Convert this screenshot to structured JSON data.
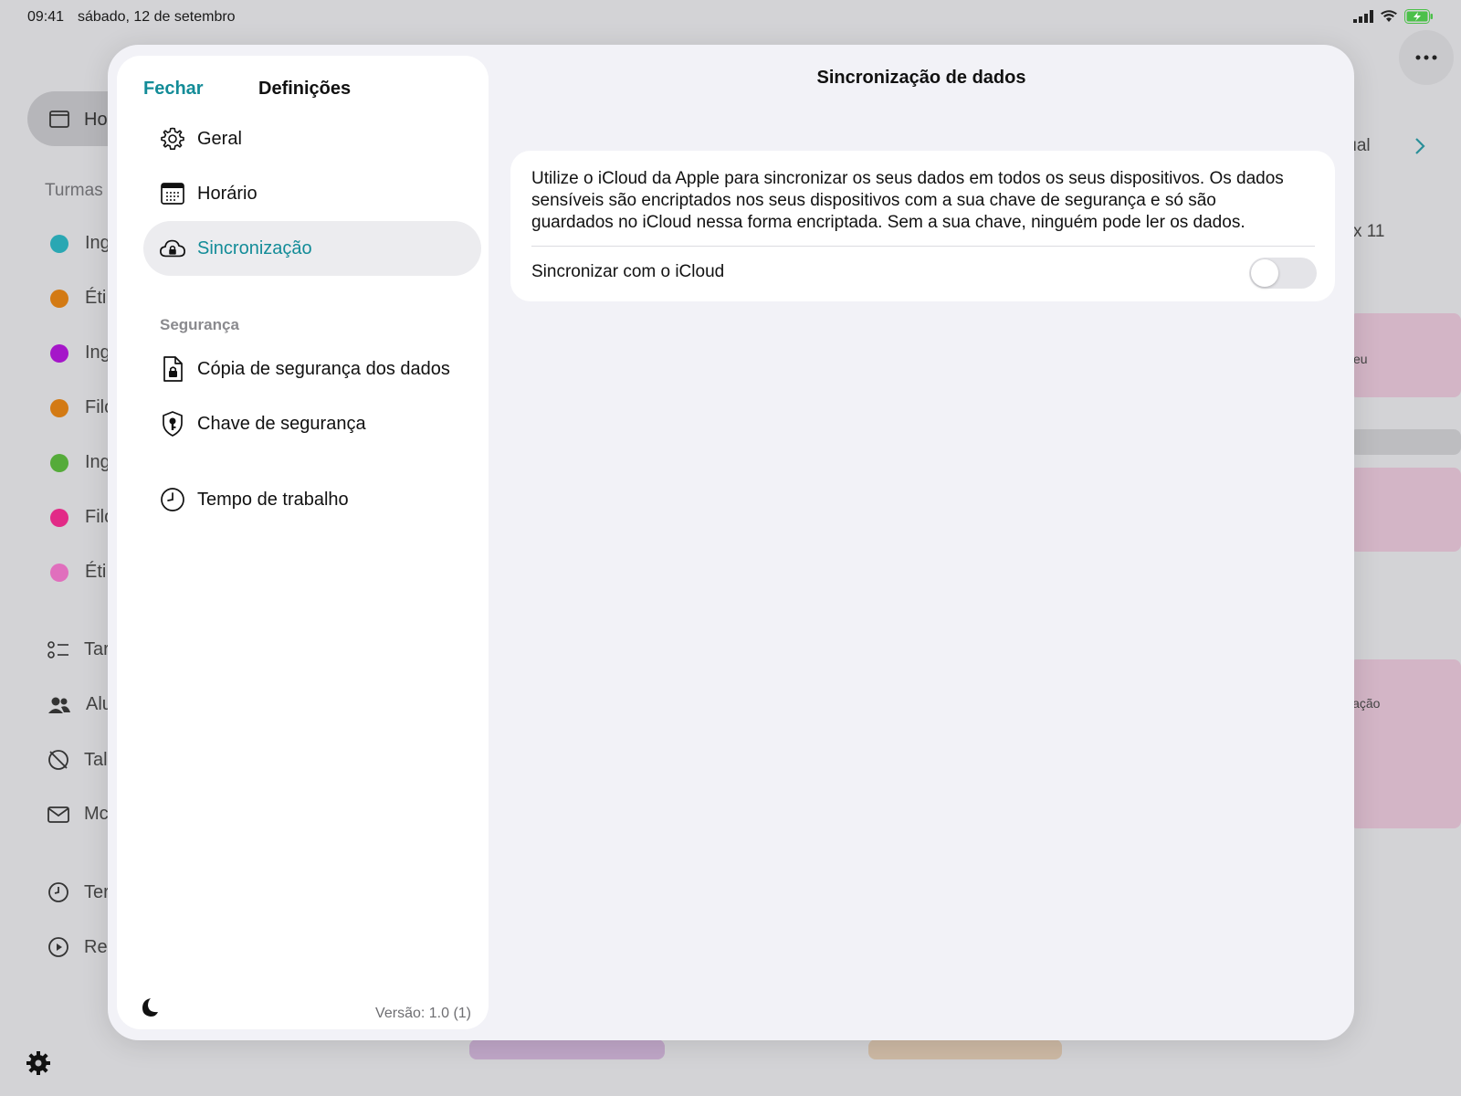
{
  "status_bar": {
    "time": "09:41",
    "date": "sábado, 12 de setembro"
  },
  "background": {
    "home_label": "Ho",
    "section_label": "Turmas",
    "classes": [
      {
        "label": "Ing",
        "color": "#2aa7b3"
      },
      {
        "label": "Éti",
        "color": "#d37a14"
      },
      {
        "label": "Ing",
        "color": "#a516c9"
      },
      {
        "label": "Filo",
        "color": "#d37a14"
      },
      {
        "label": "Ing",
        "color": "#55ab3a"
      },
      {
        "label": "Filo",
        "color": "#e22a87"
      },
      {
        "label": "Éti",
        "color": "#e06fbd"
      }
    ],
    "nav": [
      {
        "label": "Tar",
        "icon": "checklist-icon"
      },
      {
        "label": "Alu",
        "icon": "people-icon"
      },
      {
        "label": "Tal",
        "icon": "no-clock-icon"
      },
      {
        "label": "Mc",
        "icon": "envelope-icon"
      },
      {
        "label": "Ter",
        "icon": "clock-icon"
      },
      {
        "label": "Re",
        "icon": "play-circle-icon"
      }
    ],
    "right_labels": {
      "atual": "tual",
      "day": "x 11",
      "block1": "eu",
      "block2": "iação"
    }
  },
  "sidebar": {
    "close_label": "Fechar",
    "title": "Definições",
    "items": [
      {
        "label": "Geral",
        "icon": "gear-icon"
      },
      {
        "label": "Horário",
        "icon": "calendar-grid-icon"
      },
      {
        "label": "Sincronização",
        "icon": "cloud-lock-icon",
        "active": true
      }
    ],
    "security_header": "Segurança",
    "security_items": [
      {
        "label": "Cópia de segurança dos dados",
        "icon": "document-lock-icon"
      },
      {
        "label": "Chave de segurança",
        "icon": "shield-key-icon"
      }
    ],
    "other_items": [
      {
        "label": "Tempo de trabalho",
        "icon": "clock-icon"
      }
    ],
    "version": "Versão: 1.0 (1)"
  },
  "detail": {
    "title": "Sincronização de dados",
    "description": "Utilize o iCloud da Apple para sincronizar os seus dados em todos os seus dispositivos. Os dados sensíveis são encriptados nos seus dispositivos com a sua chave de segurança e só são guardados no iCloud nessa forma encriptada. Sem a sua chave, ninguém pode ler os dados.",
    "toggle_label": "Sincronizar com o iCloud",
    "toggle_on": false
  },
  "colors": {
    "accent": "#138c98"
  }
}
